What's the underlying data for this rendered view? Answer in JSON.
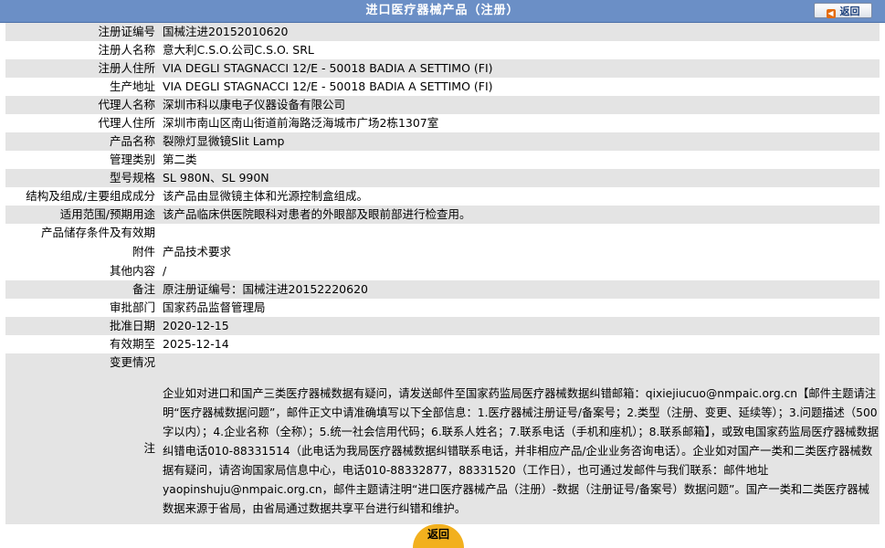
{
  "header": {
    "title": "进口医疗器械产品（注册）",
    "back_label": "返回"
  },
  "rows": [
    {
      "label": "注册证编号",
      "value": "国械注进20152010620"
    },
    {
      "label": "注册人名称",
      "value": "意大利C.S.O.公司C.S.O. SRL"
    },
    {
      "label": "注册人住所",
      "value": "VIA DEGLI STAGNACCI 12/E - 50018 BADIA A SETTIMO (FI)"
    },
    {
      "label": "生产地址",
      "value": "VIA DEGLI STAGNACCI 12/E - 50018 BADIA A SETTIMO (FI)"
    },
    {
      "label": "代理人名称",
      "value": "深圳市科以康电子仪器设备有限公司"
    },
    {
      "label": "代理人住所",
      "value": "深圳市南山区南山街道前海路泛海城市广场2栋1307室"
    },
    {
      "label": "产品名称",
      "value": "裂隙灯显微镜Slit Lamp"
    },
    {
      "label": "管理类别",
      "value": "第二类"
    },
    {
      "label": "型号规格",
      "value": "SL 980N、SL 990N"
    },
    {
      "label": "结构及组成/主要组成成分",
      "value": "该产品由显微镜主体和光源控制盒组成。"
    },
    {
      "label": "适用范围/预期用途",
      "value": "该产品临床供医院眼科对患者的外眼部及眼前部进行检查用。"
    },
    {
      "label": "产品储存条件及有效期",
      "value": ""
    },
    {
      "label": "附件",
      "value": "产品技术要求"
    },
    {
      "label": "其他内容",
      "value": "/"
    },
    {
      "label": "备注",
      "value": "原注册证编号：国械注进20152220620"
    },
    {
      "label": "审批部门",
      "value": "国家药品监督管理局"
    },
    {
      "label": "批准日期",
      "value": "2020-12-15"
    },
    {
      "label": "有效期至",
      "value": "2025-12-14"
    },
    {
      "label": "变更情况",
      "value": ""
    }
  ],
  "note": {
    "label": "注",
    "text": "企业如对进口和国产三类医疗器械数据有疑问，请发送邮件至国家药监局医疗器械数据纠错邮箱：qixiejiucuo@nmpaic.org.cn【邮件主题请注明“医疗器械数据问题”，邮件正文中请准确填写以下全部信息：1.医疗器械注册证号/备案号；2.类型（注册、变更、延续等）；3.问题描述（500字以内）；4.企业名称（全称）；5.统一社会信用代码；6.联系人姓名；7.联系电话（手机和座机）；8.联系邮箱】，或致电国家药监局医疗器械数据纠错电话010-88331514（此电话为我局医疗器械数据纠错联系电话，并非相应产品/企业业务咨询电话）。企业如对国产一类和二类医疗器械数据有疑问，请咨询国家局信息中心，电话010-88332877，88331520（工作日），也可通过发邮件与我们联系：邮件地址yaopinshuju@nmpaic.org.cn，邮件主题请注明“进口医疗器械产品（注册）-数据（注册证号/备案号）数据问题”。国产一类和二类医疗器械数据来源于省局，由省局通过数据共享平台进行纠错和维护。"
  },
  "footer": {
    "back_label": "返回"
  }
}
